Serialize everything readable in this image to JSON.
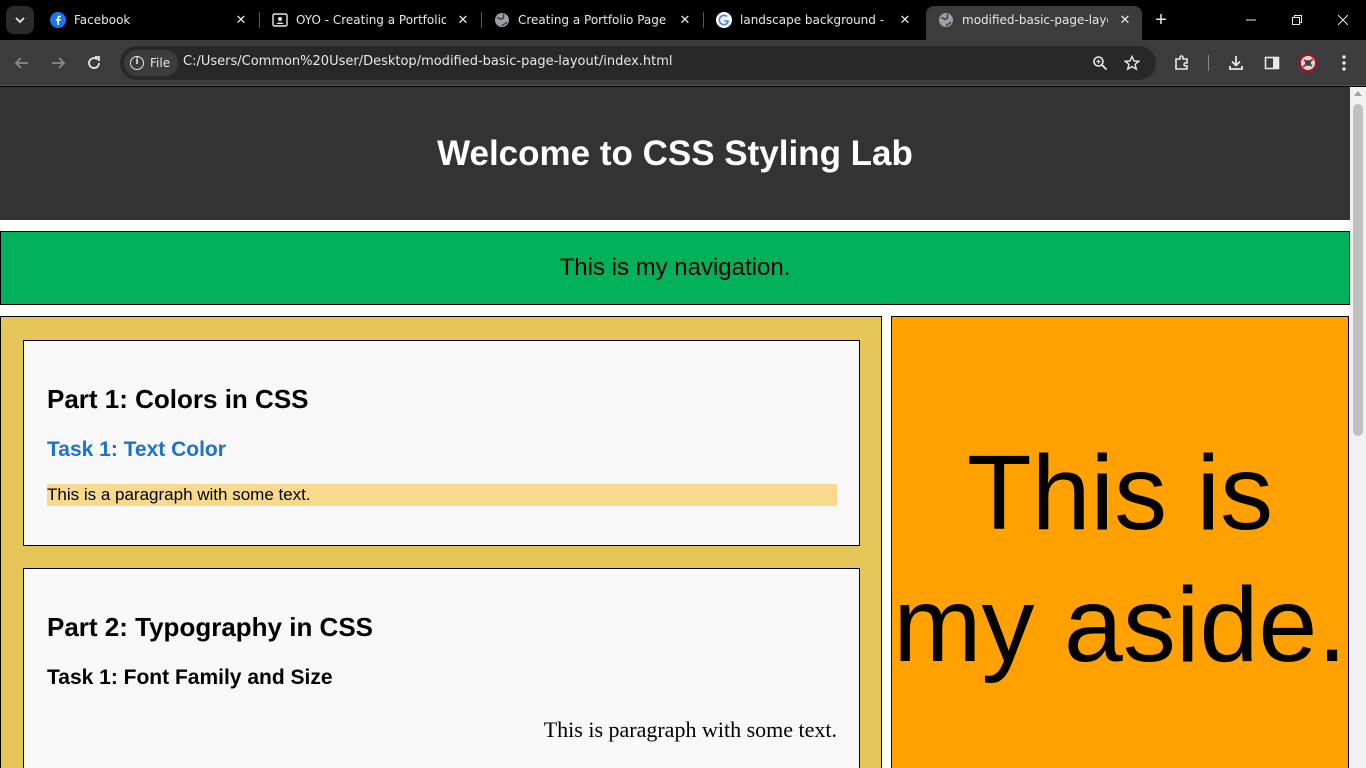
{
  "browser": {
    "tabs": [
      {
        "title": "Facebook",
        "icon": "facebook-icon"
      },
      {
        "title": "OYO - Creating a Portfolio Pa",
        "icon": "classroom-icon"
      },
      {
        "title": "Creating a Portfolio Page",
        "icon": "globe-icon"
      },
      {
        "title": "landscape background - Goo",
        "icon": "google-icon"
      },
      {
        "title": "modified-basic-page-layout",
        "icon": "globe-icon",
        "active": true
      }
    ],
    "address_chip": "File",
    "url": "C:/Users/Common%20User/Desktop/modified-basic-page-layout/index.html"
  },
  "page": {
    "header_title": "Welcome to CSS Styling Lab",
    "nav_text": "This is my navigation.",
    "sections": [
      {
        "heading": "Part 1: Colors in CSS",
        "task": "Task 1: Text Color",
        "paragraph": "This is a paragraph with some text."
      },
      {
        "heading": "Part 2: Typography in CSS",
        "task": "Task 1: Font Family and Size",
        "paragraph": "This is paragraph with some text."
      }
    ],
    "aside_text": "This is my aside."
  },
  "colors": {
    "header_bg": "#333333",
    "nav_bg": "#00b159",
    "main_bg": "#e6c558",
    "section_bg": "#f8f8f8",
    "task_link_color": "#1a73d1",
    "highlight_bg": "#f9d98d",
    "aside_bg": "#ffa100"
  }
}
